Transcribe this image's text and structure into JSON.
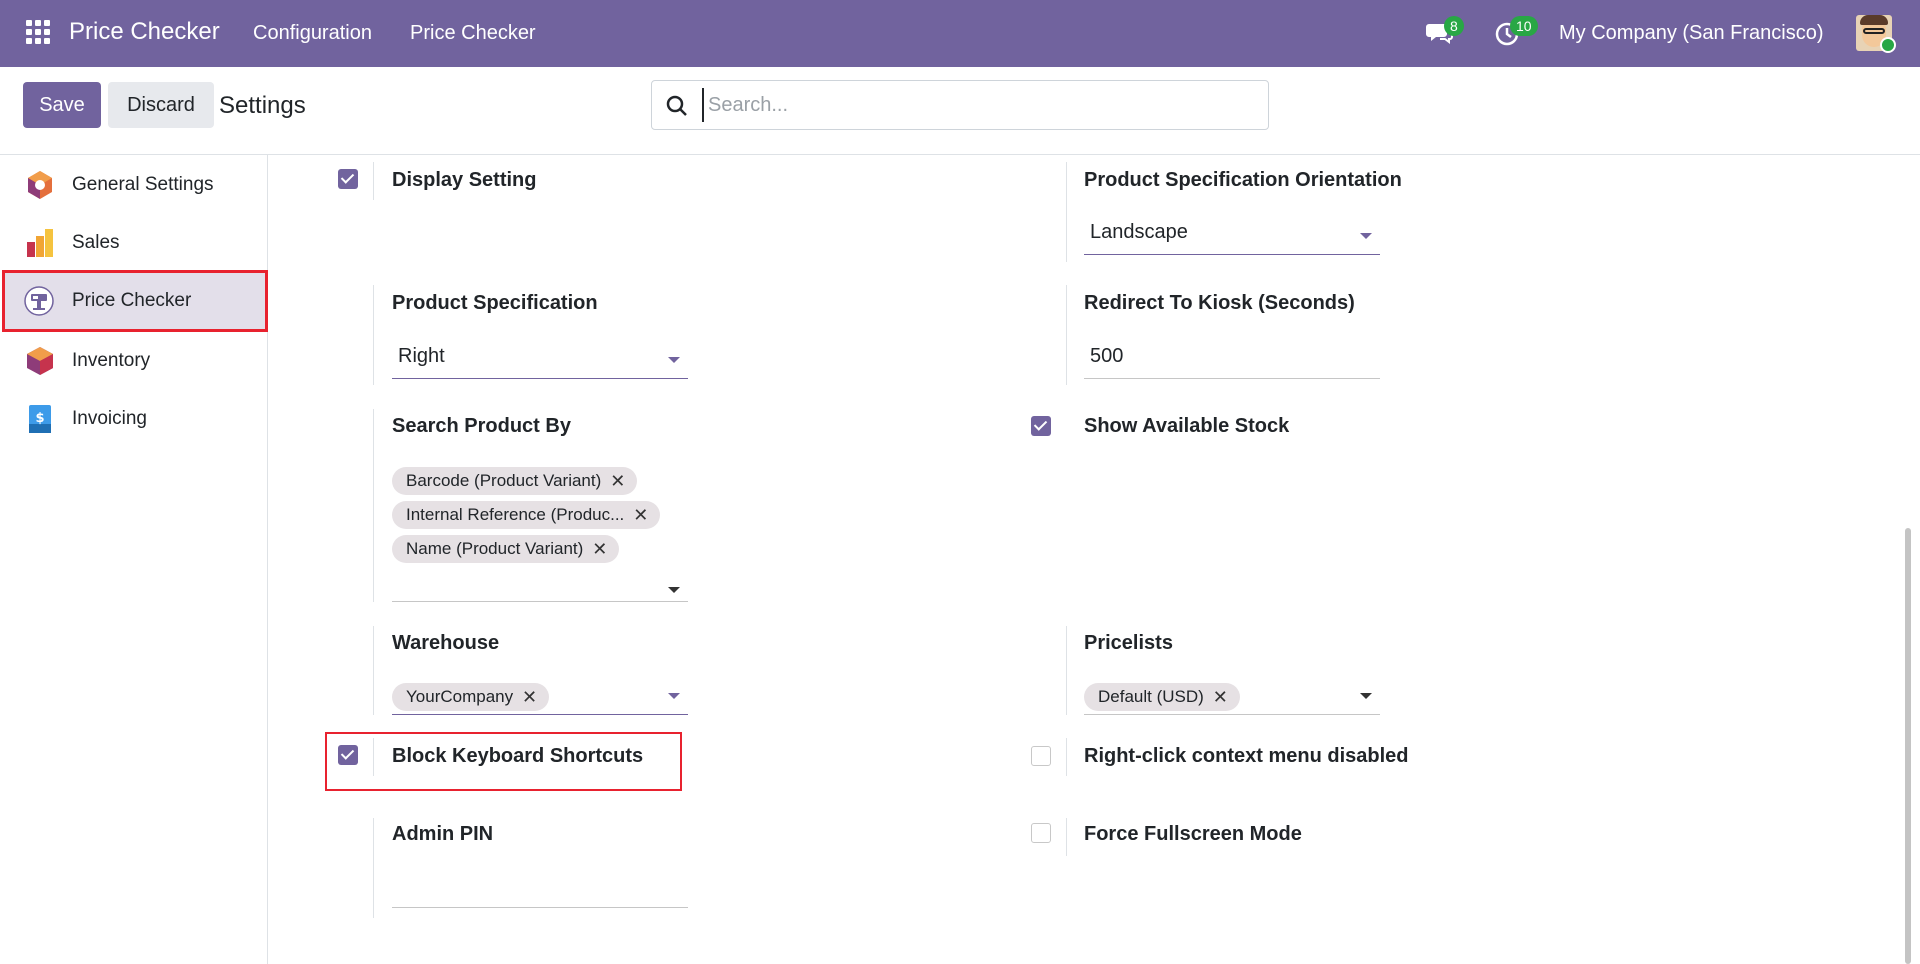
{
  "navbar": {
    "brand": "Price Checker",
    "menu": [
      "Configuration",
      "Price Checker"
    ],
    "messages_count": "8",
    "activities_count": "10",
    "company": "My Company (San Francisco)"
  },
  "control": {
    "save_label": "Save",
    "discard_label": "Discard",
    "title": "Settings",
    "search_placeholder": "Search..."
  },
  "sidebar": {
    "items": [
      {
        "label": "General Settings",
        "icon": "general-settings-icon"
      },
      {
        "label": "Sales",
        "icon": "sales-icon"
      },
      {
        "label": "Price Checker",
        "icon": "price-checker-icon",
        "active": true
      },
      {
        "label": "Inventory",
        "icon": "inventory-icon"
      },
      {
        "label": "Invoicing",
        "icon": "invoicing-icon"
      }
    ]
  },
  "settings": {
    "display_setting": {
      "label": "Display Setting",
      "checked": true
    },
    "product_spec_orientation": {
      "label": "Product Specification Orientation",
      "value": "Landscape"
    },
    "product_specification": {
      "label": "Product Specification",
      "value": "Right"
    },
    "redirect_to_kiosk": {
      "label": "Redirect To Kiosk (Seconds)",
      "value": "500"
    },
    "search_product_by": {
      "label": "Search Product By",
      "tags": [
        "Barcode (Product Variant)",
        "Internal Reference (Produc...",
        "Name (Product Variant)"
      ]
    },
    "show_available_stock": {
      "label": "Show Available Stock",
      "checked": true
    },
    "warehouse": {
      "label": "Warehouse",
      "tags": [
        "YourCompany"
      ]
    },
    "pricelists": {
      "label": "Pricelists",
      "tags": [
        "Default (USD)"
      ]
    },
    "block_keyboard_shortcuts": {
      "label": "Block Keyboard Shortcuts",
      "checked": true
    },
    "right_click_disabled": {
      "label": "Right-click context menu disabled",
      "checked": false
    },
    "admin_pin": {
      "label": "Admin PIN",
      "value": ""
    },
    "force_fullscreen": {
      "label": "Force Fullscreen Mode",
      "checked": false
    }
  },
  "colors": {
    "brand": "#71639e",
    "highlight": "#e8222f",
    "badge": "#28a745"
  }
}
